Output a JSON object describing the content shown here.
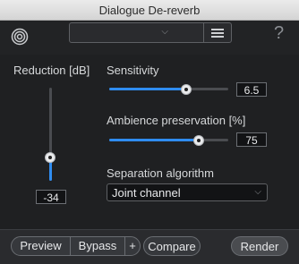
{
  "window": {
    "title": "Dialogue De-reverb"
  },
  "header": {
    "help_label": "?",
    "preset_value": ""
  },
  "reduction": {
    "label": "Reduction [dB]",
    "value": "-34",
    "level_fraction": 0.25
  },
  "sensitivity": {
    "label": "Sensitivity",
    "value": "6.5",
    "level_fraction": 0.65
  },
  "ambience": {
    "label": "Ambience preservation [%]",
    "value": "75",
    "level_fraction": 0.75
  },
  "separation": {
    "label": "Separation algorithm",
    "value": "Joint channel"
  },
  "footer": {
    "preview_label": "Preview",
    "bypass_label": "Bypass",
    "plus_label": "+",
    "compare_label": "Compare",
    "render_label": "Render"
  },
  "colors": {
    "accent": "#2f8cf0",
    "background": "#1f2022"
  }
}
